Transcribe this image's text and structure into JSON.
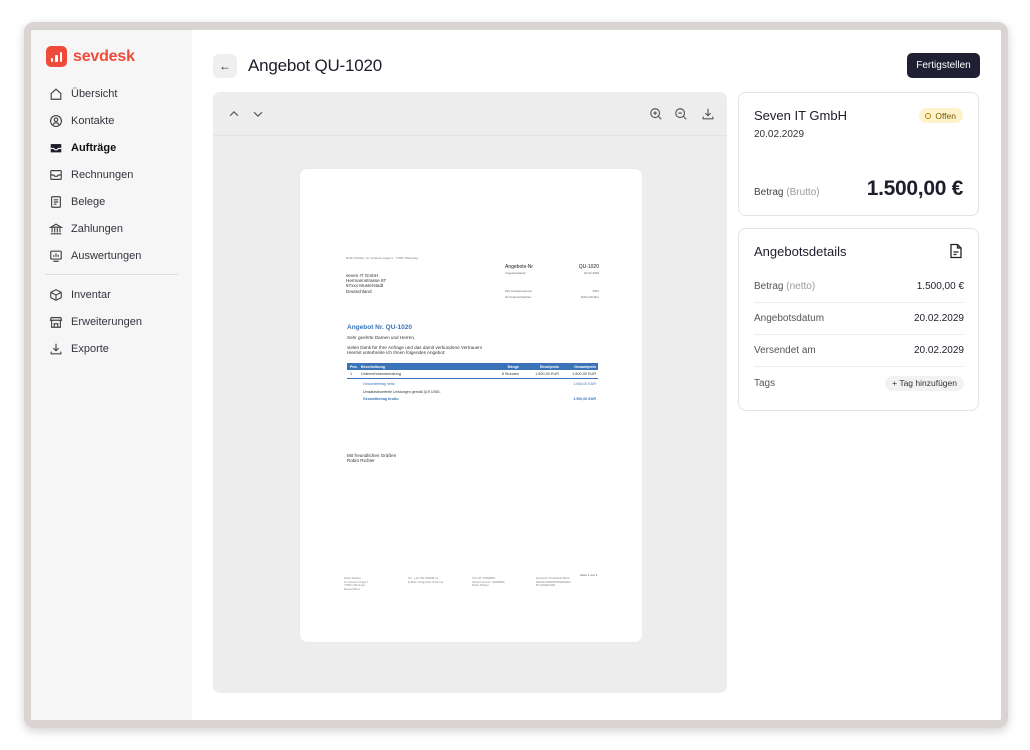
{
  "app": {
    "brand": "sevdesk",
    "brand_color": "#ef4b3b"
  },
  "sidebar": {
    "items": [
      {
        "label": "Übersicht",
        "icon": "home-icon"
      },
      {
        "label": "Kontakte",
        "icon": "contact-icon"
      },
      {
        "label": "Aufträge",
        "icon": "inbox-icon",
        "active": true
      },
      {
        "label": "Rechnungen",
        "icon": "invoice-icon"
      },
      {
        "label": "Belege",
        "icon": "receipt-icon"
      },
      {
        "label": "Zahlungen",
        "icon": "bank-icon"
      },
      {
        "label": "Auswertungen",
        "icon": "chart-icon"
      }
    ],
    "items2": [
      {
        "label": "Inventar",
        "icon": "box-icon"
      },
      {
        "label": "Erweiterungen",
        "icon": "store-icon"
      },
      {
        "label": "Exporte",
        "icon": "download-icon"
      }
    ]
  },
  "header": {
    "title": "Angebot QU-1020",
    "back_label": "←",
    "finish_label": "Fertigstellen"
  },
  "summary": {
    "company": "Seven IT GmbH",
    "date": "20.02.2029",
    "status": "Offen",
    "amount_label": "Betrag",
    "amount_qualifier": "(Brutto)",
    "amount_value": "1.500,00 €"
  },
  "details": {
    "title": "Angebotsdetails",
    "rows": [
      {
        "label": "Betrag",
        "qualifier": "(netto)",
        "value": "1.500,00 €"
      },
      {
        "label": "Angebotsdatum",
        "value": "20.02.2029"
      },
      {
        "label": "Versendet am",
        "value": "20.02.2029"
      }
    ],
    "tags_label": "Tags",
    "tag_button": "+ Tag hinzufügen"
  },
  "document": {
    "sender_line": "Robin Richter | Im schönen Angel 1 · 77652 Offenburg",
    "recipient": [
      "seven IT GmbH",
      "Hermannstrasse 87",
      "67xxx Musterstadt",
      "Deutschland"
    ],
    "meta": [
      {
        "label": "Angebots-Nr",
        "value": "QU-1020"
      },
      {
        "label": "Angebotsdatum",
        "value": "20.02.2029"
      },
      {
        "label": "Ihre Kundennummer",
        "value": "1001"
      },
      {
        "label": "Ihr Ansprechpartner",
        "value": "Robin Richter"
      }
    ],
    "title": "Angebot Nr. QU-1020",
    "greeting": "Sehr geehrte Damen und Herren,",
    "intro1": "vielen Dank für Ihre Anfrage und das damit verbundene Vertrauen!",
    "intro2": "Hiermit unterbreite ich Ihnen folgendes Angebot:",
    "columns": [
      "Pos.",
      "Beschreibung",
      "Menge",
      "Einzelpreis",
      "Gesamtpreis"
    ],
    "rows": [
      [
        "1",
        "Unternehmensberatung",
        "8 Stunden",
        "1.500,00 EUR",
        "1.500,00 EUR"
      ]
    ],
    "net_label": "Gesamtbetrag netto",
    "net_value": "1.500,00 EUR",
    "tax_note": "Umsatzsteuerfreie Leistungen gemäß §19 UStG.",
    "gross_label": "Gesamtbetrag brutto",
    "gross_value": "1.500,00 EUR",
    "closing1": "Mit freundlichen Grüßen",
    "closing2": "Robin Richter",
    "page_label": "Seite 1 von 1",
    "footer": [
      [
        "Robin Richter",
        "Im schönen Angel 1",
        "77652 Offenburg",
        "Deutschland"
      ],
      [
        "Tel.: +49 781 239498-10",
        "E-Mail: info@robin-richter.de"
      ],
      [
        "USt.-ID: 45998865",
        "Steuernummer: 44998865",
        "Robin Richter"
      ],
      [
        "Deutsche Kreditbank Berlin",
        "DE01123900000000000000",
        "BYLADEM1001"
      ]
    ]
  }
}
